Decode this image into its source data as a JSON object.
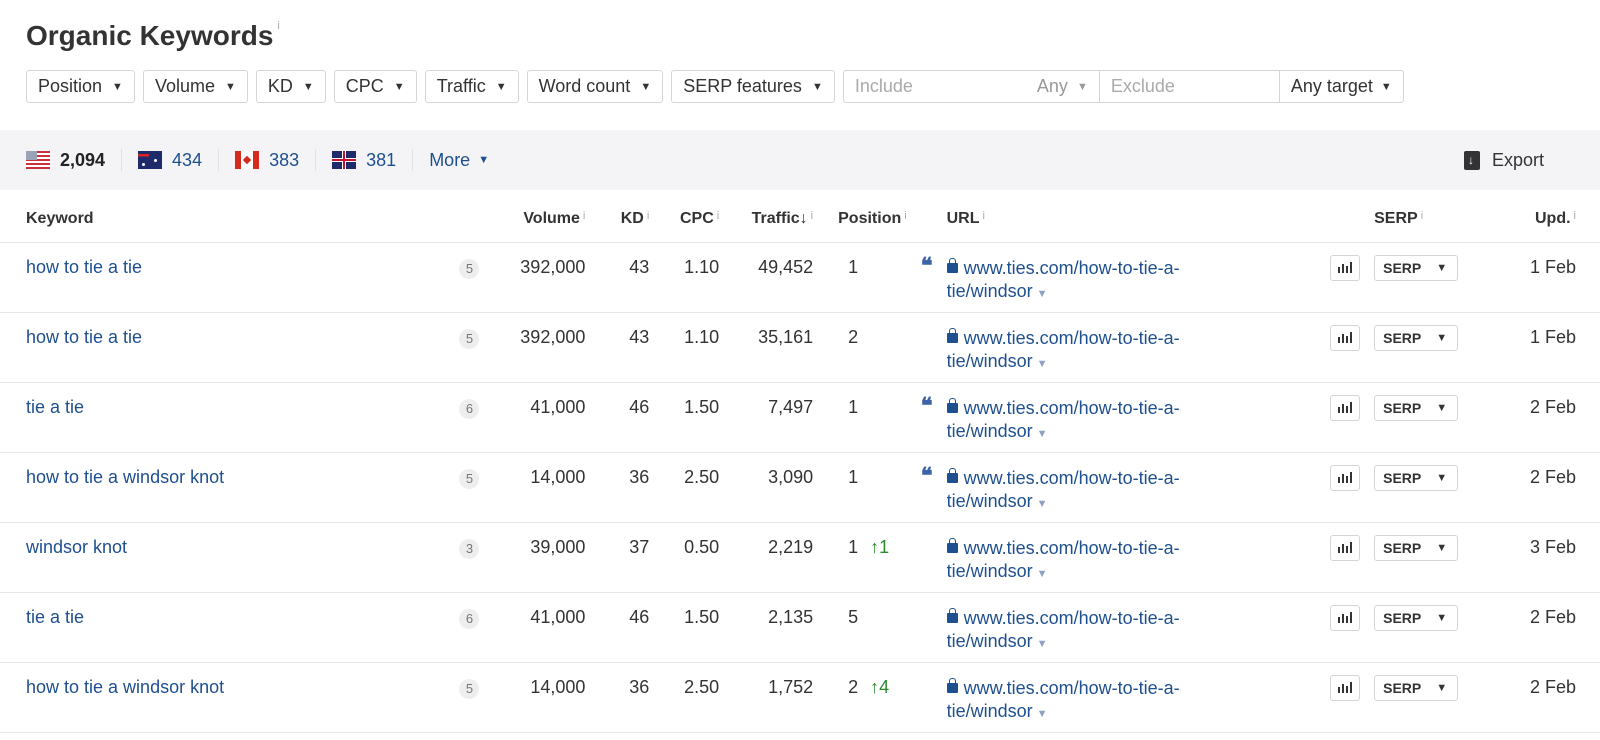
{
  "page": {
    "title": "Organic Keywords",
    "info_marker": "i"
  },
  "filters": {
    "buttons": [
      "Position",
      "Volume",
      "KD",
      "CPC",
      "Traffic",
      "Word count",
      "SERP features"
    ],
    "include_placeholder": "Include",
    "include_mode": "Any",
    "exclude_placeholder": "Exclude",
    "target": "Any target"
  },
  "countries": [
    {
      "code": "us",
      "count": "2,094"
    },
    {
      "code": "au",
      "count": "434"
    },
    {
      "code": "ca",
      "count": "383"
    },
    {
      "code": "gb",
      "count": "381"
    }
  ],
  "more_label": "More",
  "export_label": "Export",
  "table": {
    "headers": {
      "keyword": "Keyword",
      "volume": "Volume",
      "kd": "KD",
      "cpc": "CPC",
      "traffic": "Traffic",
      "traffic_sort": "↓",
      "position": "Position",
      "url": "URL",
      "serp": "SERP",
      "upd": "Upd."
    },
    "serp_button_label": "SERP",
    "rows": [
      {
        "keyword": "how to tie a tie",
        "words": "5",
        "volume": "392,000",
        "kd": "43",
        "cpc": "1.10",
        "traffic": "49,452",
        "position": "1",
        "position_change": "",
        "featured_snippet": true,
        "url_line1": "www.ties.com/how-to-tie-a-",
        "url_line2": "tie/windsor",
        "updated": "1 Feb"
      },
      {
        "keyword": "how to tie a tie",
        "words": "5",
        "volume": "392,000",
        "kd": "43",
        "cpc": "1.10",
        "traffic": "35,161",
        "position": "2",
        "position_change": "",
        "featured_snippet": false,
        "url_line1": "www.ties.com/how-to-tie-a-",
        "url_line2": "tie/windsor",
        "updated": "1 Feb"
      },
      {
        "keyword": "tie a tie",
        "words": "6",
        "volume": "41,000",
        "kd": "46",
        "cpc": "1.50",
        "traffic": "7,497",
        "position": "1",
        "position_change": "",
        "featured_snippet": true,
        "url_line1": "www.ties.com/how-to-tie-a-",
        "url_line2": "tie/windsor",
        "updated": "2 Feb"
      },
      {
        "keyword": "how to tie a windsor knot",
        "words": "5",
        "volume": "14,000",
        "kd": "36",
        "cpc": "2.50",
        "traffic": "3,090",
        "position": "1",
        "position_change": "",
        "featured_snippet": true,
        "url_line1": "www.ties.com/how-to-tie-a-",
        "url_line2": "tie/windsor",
        "updated": "2 Feb"
      },
      {
        "keyword": "windsor knot",
        "words": "3",
        "volume": "39,000",
        "kd": "37",
        "cpc": "0.50",
        "traffic": "2,219",
        "position": "1",
        "position_change": "↑1",
        "featured_snippet": false,
        "url_line1": "www.ties.com/how-to-tie-a-",
        "url_line2": "tie/windsor",
        "updated": "3 Feb"
      },
      {
        "keyword": "tie a tie",
        "words": "6",
        "volume": "41,000",
        "kd": "46",
        "cpc": "1.50",
        "traffic": "2,135",
        "position": "5",
        "position_change": "",
        "featured_snippet": false,
        "url_line1": "www.ties.com/how-to-tie-a-",
        "url_line2": "tie/windsor",
        "updated": "2 Feb"
      },
      {
        "keyword": "how to tie a windsor knot",
        "words": "5",
        "volume": "14,000",
        "kd": "36",
        "cpc": "2.50",
        "traffic": "1,752",
        "position": "2",
        "position_change": "↑4",
        "featured_snippet": false,
        "url_line1": "www.ties.com/how-to-tie-a-",
        "url_line2": "tie/windsor",
        "updated": "2 Feb"
      }
    ]
  },
  "colors": {
    "link": "#1e4f8f",
    "position_up": "#2a8a2a",
    "country_bar_bg": "#f4f4f7"
  }
}
